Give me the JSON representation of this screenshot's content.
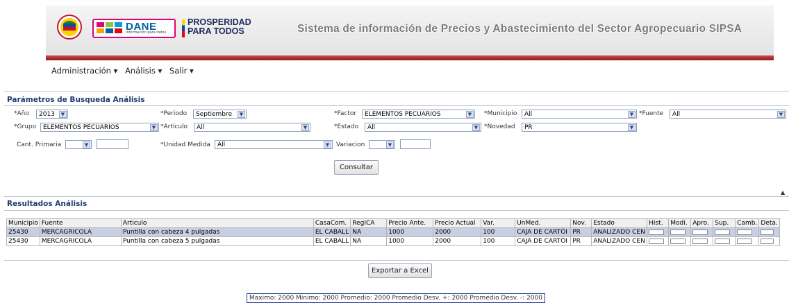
{
  "header": {
    "dane_logo_text": "DANE",
    "dane_logo_sub": "Información para todos",
    "prosperidad_text": "PROSPERIDAD PARA TODOS",
    "site_title": "Sistema de información de Precios y Abastecimiento del Sector Agropecuario SIPSA",
    "colors": {
      "stripe": "#8e1b1b",
      "dane": "#005fa8",
      "accent": "#e3007d"
    }
  },
  "menu": [
    {
      "label": "Administración ▾"
    },
    {
      "label": "Análisis ▾"
    },
    {
      "label": "Salir ▾"
    }
  ],
  "params": {
    "title": "Parámetros de Busqueda Análisis",
    "anio": {
      "label": "*Año",
      "value": "2013"
    },
    "periodo": {
      "label": "*Periodo",
      "value": "Septiembre"
    },
    "factor": {
      "label": "*Factor",
      "value": "ELEMENTOS PECUARIOS"
    },
    "municipio": {
      "label": "*Municipio",
      "value": "All"
    },
    "fuente": {
      "label": "*Fuente",
      "value": "All"
    },
    "grupo": {
      "label": "*Grupo",
      "value": "ELEMENTOS PECUARIOS"
    },
    "articulo": {
      "label": "*Artículo",
      "value": "All"
    },
    "estado": {
      "label": "*Estado",
      "value": "All"
    },
    "novedad": {
      "label": "*Novedad",
      "value": "PR"
    },
    "cant_primaria": {
      "label": "Cant. Primaria",
      "value": ""
    },
    "unidad_medida": {
      "label": "*Unidad Medida",
      "value": "All"
    },
    "variacion": {
      "label": "Variacion",
      "value": ""
    },
    "consultar_label": "Consultar"
  },
  "results": {
    "title": "Resultados Análisis",
    "columns": [
      "Municipio",
      "Fuente",
      "Articulo",
      "CasaCom.",
      "RegICA",
      "Precio Ante.",
      "Precio Actual",
      "Var.",
      "UnMed.",
      "Nov.",
      "Estado",
      "Hist.",
      "Modi.",
      "Apro.",
      "Sup.",
      "Camb.",
      "Deta."
    ],
    "rows": [
      [
        "25430",
        "MERCAGRICOLA",
        "Puntilla con cabeza 4 pulgadas",
        "EL CABALL",
        "NA",
        "1000",
        "2000",
        "100",
        "CAJA DE CARTÓI",
        "PR",
        "ANALIZADO CEN"
      ],
      [
        "25430",
        "MERCAGRICOLA",
        "Puntilla con cabeza 5 pulgadas",
        "EL CABALL",
        "NA",
        "1000",
        "2000",
        "100",
        "CAJA DE CARTÓI",
        "PR",
        "ANALIZADO CEN"
      ]
    ],
    "export_label": "Exportar a Excel",
    "stats": "Maximo: 2000 Minimo: 2000 Promedio: 2000 Promedio Desv. +: 2000 Promedio Desv. -: 2000"
  }
}
